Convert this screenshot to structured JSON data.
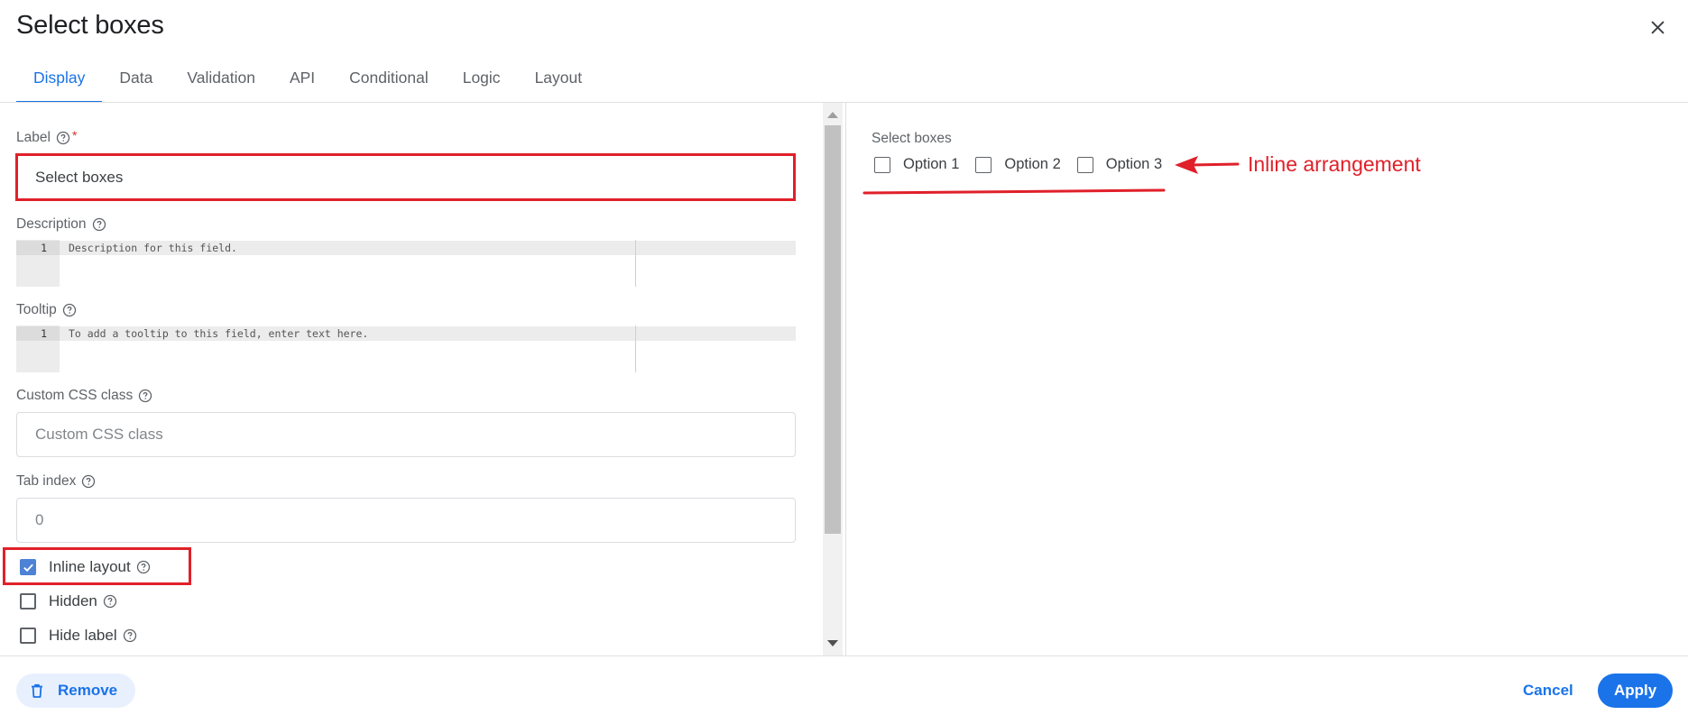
{
  "dialog": {
    "title": "Select boxes"
  },
  "tabs": [
    {
      "label": "Display",
      "active": true
    },
    {
      "label": "Data"
    },
    {
      "label": "Validation"
    },
    {
      "label": "API"
    },
    {
      "label": "Conditional"
    },
    {
      "label": "Logic"
    },
    {
      "label": "Layout"
    }
  ],
  "fields": {
    "label": {
      "label": "Label",
      "required_mark": "*",
      "value": "Select boxes"
    },
    "description": {
      "label": "Description",
      "line_number": "1",
      "placeholder": "Description for this field."
    },
    "tooltip": {
      "label": "Tooltip",
      "line_number": "1",
      "placeholder": "To add a tooltip to this field, enter text here."
    },
    "custom_css": {
      "label": "Custom CSS class",
      "placeholder": "Custom CSS class"
    },
    "tab_index": {
      "label": "Tab index",
      "placeholder": "0"
    },
    "inline_layout": {
      "label": "Inline layout",
      "checked": true
    },
    "hidden": {
      "label": "Hidden",
      "checked": false
    },
    "hide_label": {
      "label": "Hide label",
      "checked": false
    }
  },
  "preview": {
    "label": "Select boxes",
    "options": [
      "Option 1",
      "Option 2",
      "Option 3"
    ],
    "annotation": "Inline arrangement"
  },
  "footer": {
    "remove_label": "Remove",
    "cancel_label": "Cancel",
    "apply_label": "Apply"
  },
  "colors": {
    "accent": "#1a73e8",
    "annotation": "#e0202a",
    "checkbox_checked": "#4d82d4"
  },
  "icons": [
    "close-icon",
    "help-icon",
    "check-icon",
    "trash-icon",
    "arrow-left-icon"
  ]
}
